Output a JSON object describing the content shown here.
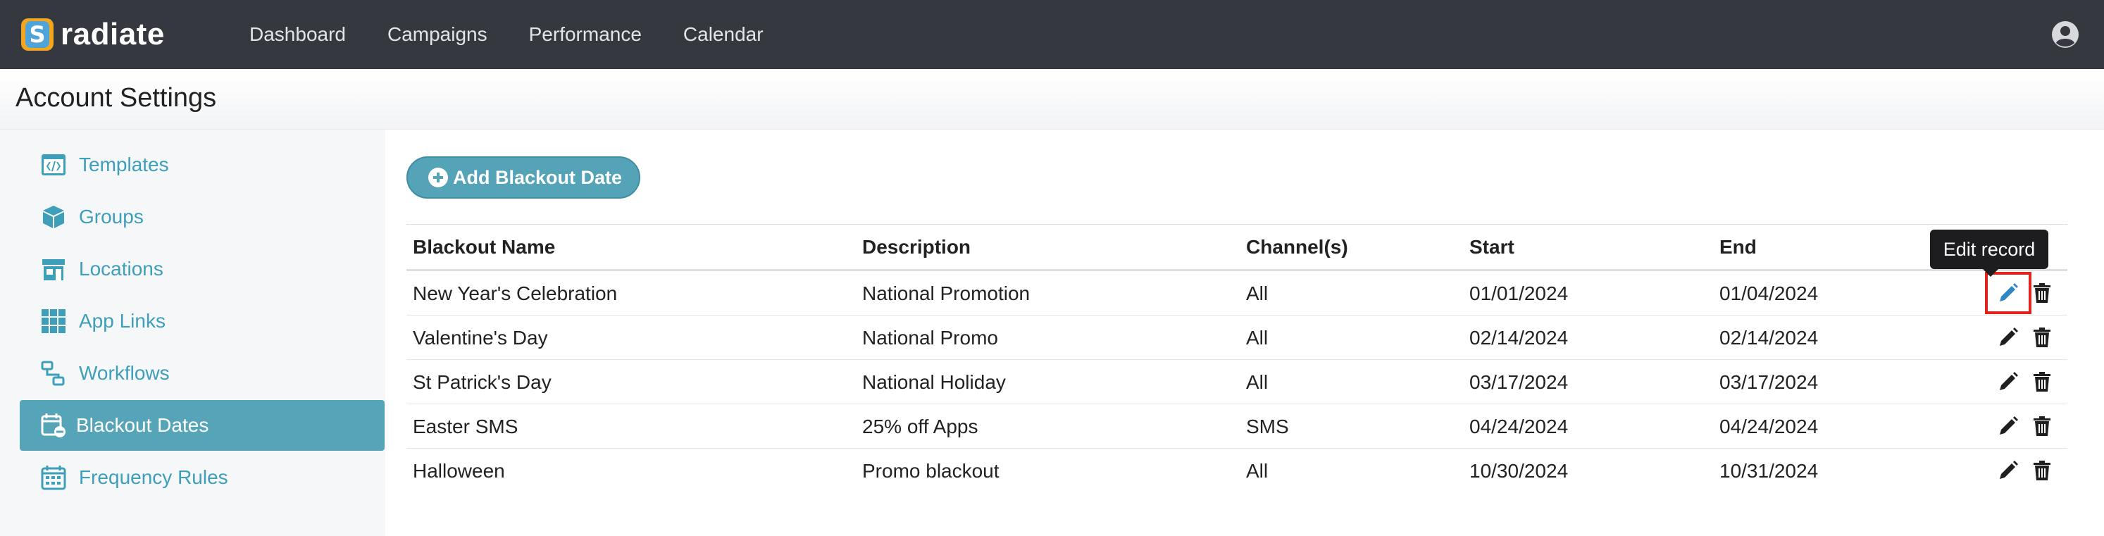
{
  "app": {
    "name": "radiate",
    "logo_glyph": "S"
  },
  "nav": {
    "items": [
      {
        "label": "Dashboard"
      },
      {
        "label": "Campaigns"
      },
      {
        "label": "Performance"
      },
      {
        "label": "Calendar"
      }
    ],
    "user_icon": "user-circle-icon"
  },
  "header": {
    "title": "Account Settings"
  },
  "sidebar": {
    "items": [
      {
        "label": "Templates",
        "icon": "code-window-icon",
        "active": false
      },
      {
        "label": "Groups",
        "icon": "cube-icon",
        "active": false
      },
      {
        "label": "Locations",
        "icon": "storefront-icon",
        "active": false
      },
      {
        "label": "App Links",
        "icon": "grid-icon",
        "active": false
      },
      {
        "label": "Workflows",
        "icon": "workflow-icon",
        "active": false
      },
      {
        "label": "Blackout Dates",
        "icon": "calendar-minus-icon",
        "active": true
      },
      {
        "label": "Frequency Rules",
        "icon": "calendar-grid-icon",
        "active": false
      }
    ]
  },
  "main": {
    "add_button_label": "Add Blackout Date",
    "table": {
      "headers": [
        "Blackout Name",
        "Description",
        "Channel(s)",
        "Start",
        "End"
      ],
      "rows": [
        {
          "name": "New Year's Celebration",
          "description": "National Promotion",
          "channels": "All",
          "start": "01/01/2024",
          "end": "01/04/2024"
        },
        {
          "name": "Valentine's Day",
          "description": "National Promo",
          "channels": "All",
          "start": "02/14/2024",
          "end": "02/14/2024"
        },
        {
          "name": "St Patrick's Day",
          "description": "National Holiday",
          "channels": "All",
          "start": "03/17/2024",
          "end": "03/17/2024"
        },
        {
          "name": "Easter SMS",
          "description": "25% off Apps",
          "channels": "SMS",
          "start": "04/24/2024",
          "end": "04/24/2024"
        },
        {
          "name": "Halloween",
          "description": "Promo blackout",
          "channels": "All",
          "start": "10/30/2024",
          "end": "10/31/2024"
        }
      ]
    },
    "tooltip": "Edit record"
  },
  "colors": {
    "topbar": "#35393f",
    "accent": "#56a4b7",
    "link": "#3e9fba",
    "highlight": "#e0231d",
    "edit_active": "#2f86c4"
  }
}
